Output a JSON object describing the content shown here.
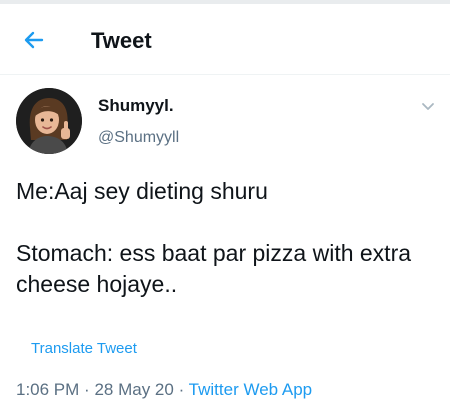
{
  "header": {
    "title": "Tweet",
    "back_icon": "arrow-left-icon"
  },
  "author": {
    "display_name": "Shumyyl.",
    "handle": "@Shumyyll"
  },
  "tweet": {
    "line1": "Me:Aaj sey dieting shuru",
    "line2": "Stomach: ess baat par pizza with extra cheese hojaye..",
    "translate_label": "Translate Tweet",
    "time": "1:06 PM",
    "date": "28 May 20",
    "separator": "·",
    "source": "Twitter Web App"
  },
  "colors": {
    "accent": "#1d9bf0",
    "secondary_text": "#5b7083",
    "primary_text": "#0f1419"
  }
}
